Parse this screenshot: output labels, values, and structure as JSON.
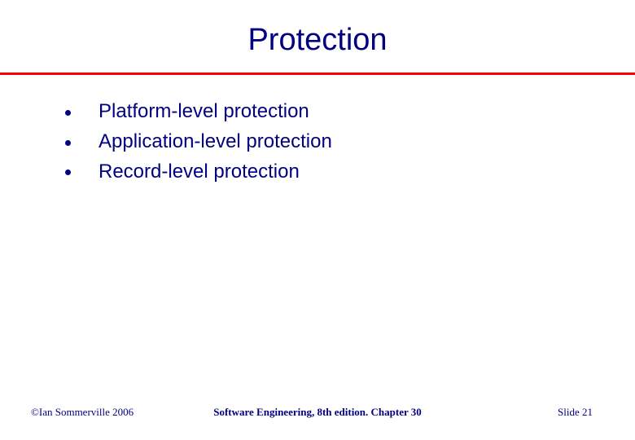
{
  "slide": {
    "title": "Protection",
    "bullets": [
      "Platform-level protection",
      "Application-level protection",
      "Record-level protection"
    ],
    "footer": {
      "copyright": "©Ian Sommerville 2006",
      "center": "Software Engineering, 8th edition. Chapter 30",
      "slide_label": "Slide 21"
    }
  }
}
